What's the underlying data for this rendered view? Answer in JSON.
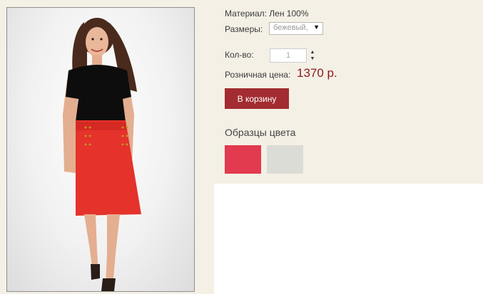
{
  "product": {
    "image_alt": "Красная юбка",
    "material": "Материал: Лен 100%",
    "sizes_label": "Размеры:",
    "size_selected": "бежевый,",
    "quantity_label": "Кол-во:",
    "quantity_value": "1",
    "price_label": "Розничная цена:",
    "price_value": "1370 р.",
    "add_to_cart": "В корзину"
  },
  "swatches": {
    "title": "Образцы цвета",
    "items": [
      {
        "color": "#e23a4f"
      },
      {
        "color": "#dcdcd6"
      }
    ]
  },
  "colors": {
    "background": "#f4f0e6",
    "button": "#a22c31",
    "price": "#8b1a1a",
    "skirt": "#e5322b",
    "top": "#0d0d0d"
  }
}
